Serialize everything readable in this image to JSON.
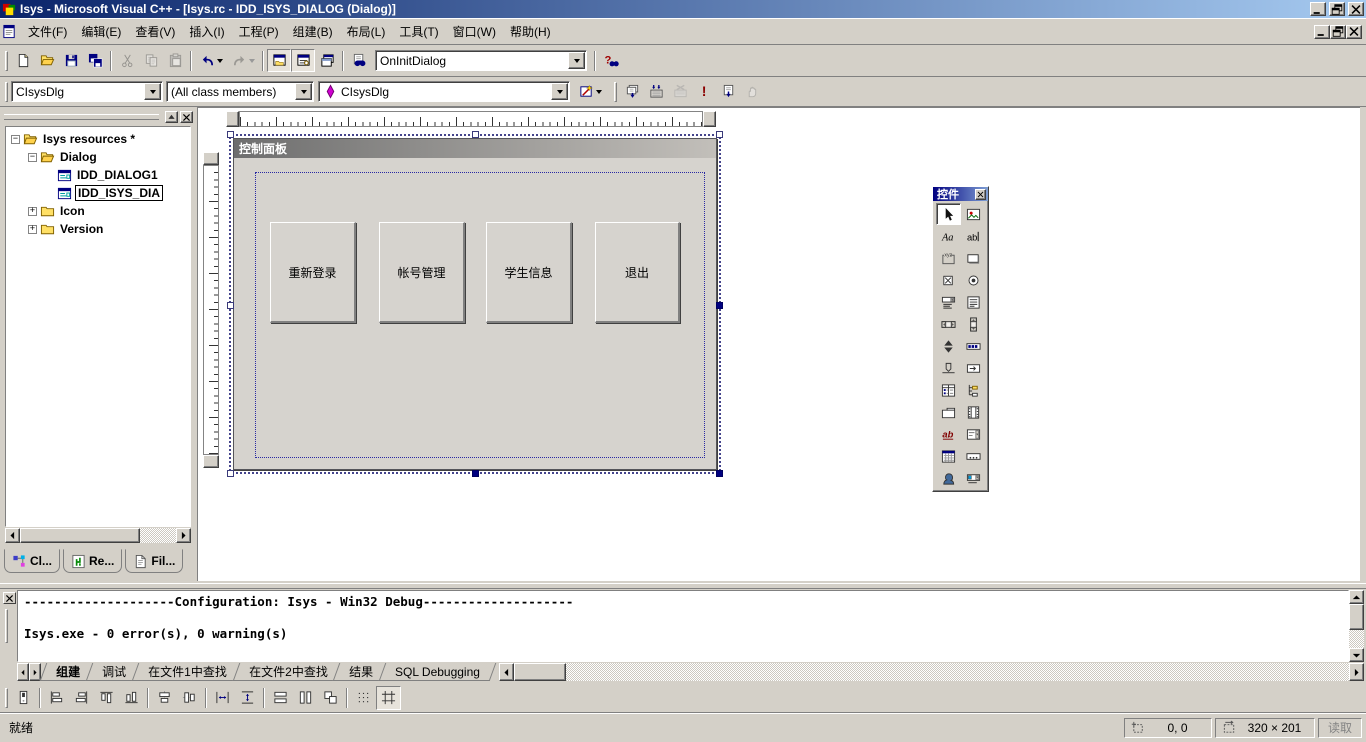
{
  "titlebar": {
    "title": "Isys - Microsoft Visual C++ - [Isys.rc - IDD_ISYS_DIALOG (Dialog)]"
  },
  "menu_bar": {
    "items": [
      "文件(F)",
      "编辑(E)",
      "查看(V)",
      "插入(I)",
      "工程(P)",
      "组建(B)",
      "布局(L)",
      "工具(T)",
      "窗口(W)",
      "帮助(H)"
    ]
  },
  "toolbar_main": {
    "buttons": [
      {
        "name": "new-file"
      },
      {
        "name": "open-file"
      },
      {
        "name": "save"
      },
      {
        "name": "save-all"
      },
      {
        "sep": true
      },
      {
        "name": "cut",
        "disabled": true
      },
      {
        "name": "copy",
        "disabled": true
      },
      {
        "name": "paste",
        "disabled": true
      },
      {
        "sep": true
      },
      {
        "name": "undo",
        "caret": true
      },
      {
        "name": "redo",
        "caret": true,
        "disabled": true
      },
      {
        "sep": true
      },
      {
        "name": "workspace-toggle",
        "pressed": true
      },
      {
        "name": "output-toggle",
        "pressed": true
      },
      {
        "name": "window-list"
      },
      {
        "sep": true
      },
      {
        "name": "find-in-files"
      }
    ],
    "find_combo": {
      "value": "OnInitDialog"
    },
    "search_buttons": [
      {
        "name": "search-help"
      }
    ]
  },
  "wizard_bar": {
    "class_combo": "CIsysDlg",
    "filter_combo": "(All class members)",
    "member_combo": "CIsysDlg",
    "action_buttons": [
      {
        "name": "wizard-actions",
        "caret": true
      }
    ],
    "build_buttons": [
      {
        "name": "compile"
      },
      {
        "name": "build"
      },
      {
        "name": "stop-build",
        "disabled": true
      },
      {
        "name": "execute-program"
      },
      {
        "name": "go"
      },
      {
        "name": "breakpoint",
        "disabled": true
      }
    ]
  },
  "workspace": {
    "tree": [
      {
        "label": "Isys resources *",
        "level": 0,
        "icon": "folder-open",
        "expander": "minus"
      },
      {
        "label": "Dialog",
        "level": 1,
        "icon": "folder-open",
        "expander": "minus"
      },
      {
        "label": "IDD_DIALOG1",
        "level": 2,
        "icon": "dialog-resource"
      },
      {
        "label": "IDD_ISYS_DIA",
        "level": 2,
        "icon": "dialog-resource",
        "selected": true
      },
      {
        "label": "Icon",
        "level": 1,
        "icon": "folder-closed",
        "expander": "plus"
      },
      {
        "label": "Version",
        "level": 1,
        "icon": "folder-closed",
        "expander": "plus"
      }
    ],
    "tabs": [
      {
        "label": "Cl...",
        "icon": "classview"
      },
      {
        "label": "Re...",
        "icon": "resourceview",
        "active": true
      },
      {
        "label": "Fil...",
        "icon": "fileview"
      }
    ]
  },
  "dialog_editor": {
    "caption": "控制面板",
    "buttons": [
      "重新登录",
      "帐号管理",
      "学生信息",
      "退出"
    ]
  },
  "controls_palette": {
    "title": "控件",
    "tools": [
      {
        "name": "select",
        "selected": true
      },
      {
        "name": "picture"
      },
      {
        "name": "static-text"
      },
      {
        "name": "edit-box"
      },
      {
        "name": "group-box"
      },
      {
        "name": "button"
      },
      {
        "name": "check-box"
      },
      {
        "name": "radio-button"
      },
      {
        "name": "combo-box"
      },
      {
        "name": "list-box"
      },
      {
        "name": "horizontal-scrollbar"
      },
      {
        "name": "vertical-scrollbar"
      },
      {
        "name": "spin"
      },
      {
        "name": "progress"
      },
      {
        "name": "slider"
      },
      {
        "name": "hot-key"
      },
      {
        "name": "list-control"
      },
      {
        "name": "tree-control"
      },
      {
        "name": "tab-control"
      },
      {
        "name": "animate"
      },
      {
        "name": "rich-edit"
      },
      {
        "name": "date-time-picker"
      },
      {
        "name": "month-calendar"
      },
      {
        "name": "ip-address"
      },
      {
        "name": "custom-control"
      },
      {
        "name": "extended-combo"
      }
    ]
  },
  "output": {
    "lines": [
      "--------------------Configuration: Isys - Win32 Debug--------------------",
      "",
      "Isys.exe - 0 error(s), 0 warning(s)"
    ],
    "tabs": [
      {
        "label": "组建",
        "active": true
      },
      {
        "label": "调试"
      },
      {
        "label": "在文件1中查找"
      },
      {
        "label": "在文件2中查找"
      },
      {
        "label": "结果"
      },
      {
        "label": "SQL Debugging"
      }
    ]
  },
  "dialog_toolbar": {
    "buttons": [
      {
        "name": "test-dialog"
      },
      {
        "sep": true
      },
      {
        "name": "align-left"
      },
      {
        "name": "align-right"
      },
      {
        "name": "align-top"
      },
      {
        "name": "align-bottom"
      },
      {
        "sep": true
      },
      {
        "name": "center-vertical"
      },
      {
        "name": "center-horizontal"
      },
      {
        "sep": true
      },
      {
        "name": "space-across"
      },
      {
        "name": "space-down"
      },
      {
        "sep": true
      },
      {
        "name": "make-same-width"
      },
      {
        "name": "make-same-height"
      },
      {
        "name": "make-same-size"
      },
      {
        "sep": true
      },
      {
        "name": "toggle-grid"
      },
      {
        "name": "toggle-guides",
        "pressed": true
      }
    ]
  },
  "status_bar": {
    "message": "就绪",
    "position": "0, 0",
    "size": "320 × 201",
    "mode": "读取"
  },
  "colors": {
    "titlebar_from": "#0A246A",
    "titlebar_to": "#A6CAF0",
    "chrome_gray": "#D4D0C8",
    "dialog_face": "#D6D3CE",
    "inactive_caption_from": "#6E6E6E",
    "inactive_caption_to": "#C2BFBA",
    "selection_handle": "#000080",
    "marquee": "#44448C",
    "execute_red": "#8B0000"
  }
}
